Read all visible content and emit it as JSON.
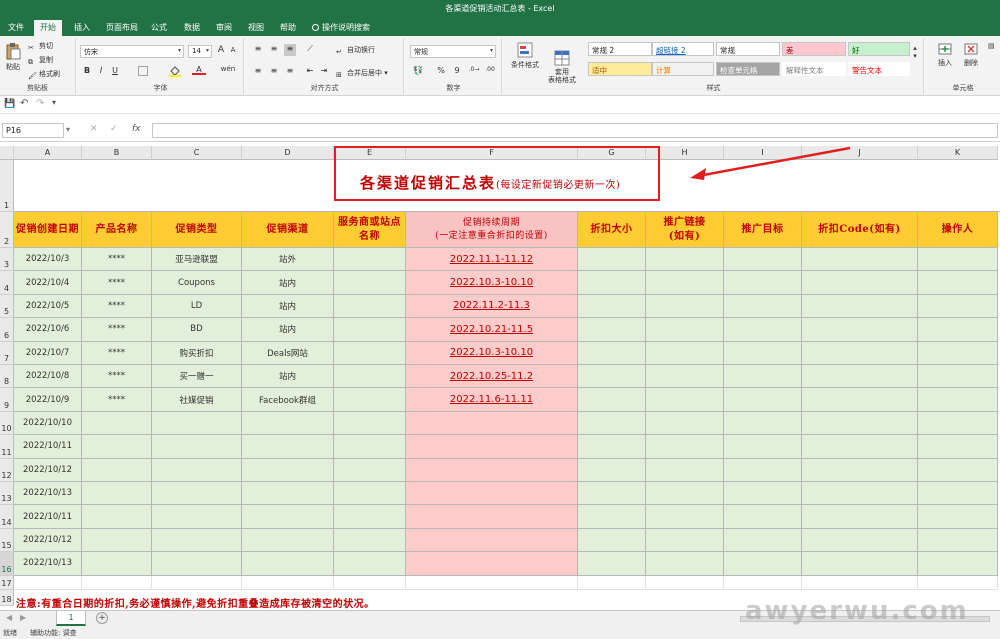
{
  "window": {
    "title": "各渠道促销活动汇总表 - Excel"
  },
  "tabs": [
    "文件",
    "开始",
    "插入",
    "页面布局",
    "公式",
    "数据",
    "审阅",
    "视图",
    "帮助",
    "操作说明搜索"
  ],
  "ribbon": {
    "clipboard": {
      "paste": "粘贴",
      "cut": "剪切",
      "copy": "复制",
      "format_painter": "格式刷",
      "label": "剪贴板"
    },
    "font": {
      "name": "仿宋",
      "size": "14",
      "bold": "B",
      "italic": "I",
      "underline": "U",
      "grow": "A",
      "shrink": "A",
      "color_a": "A",
      "wen": "wén",
      "label": "字体"
    },
    "alignment": {
      "wrap": "自动换行",
      "merge": "合并后居中",
      "label": "对齐方式"
    },
    "number": {
      "format": "常规",
      "percent": "%",
      "comma": "9",
      "label": "数字"
    },
    "styles": {
      "conditional": "条件格式",
      "table": "套用\n表格格式",
      "cells": [
        {
          "text": "常规 2",
          "bg": "#ffffff",
          "fg": "#222222"
        },
        {
          "text": "超链接 2",
          "bg": "#ffffff",
          "fg": "#0563c1"
        },
        {
          "text": "常规",
          "bg": "#ffffff",
          "fg": "#222222"
        },
        {
          "text": "差",
          "bg": "#ffc7ce",
          "fg": "#9c0006"
        },
        {
          "text": "好",
          "bg": "#c6efce",
          "fg": "#006100"
        },
        {
          "text": "适中",
          "bg": "#ffeb9c",
          "fg": "#9c5700"
        },
        {
          "text": "计算",
          "bg": "#f2f2f2",
          "fg": "#fa7d00"
        },
        {
          "text": "检查单元格",
          "bg": "#a5a5a5",
          "fg": "#ffffff"
        },
        {
          "text": "解释性文本",
          "bg": "#ffffff",
          "fg": "#7f7f7f"
        },
        {
          "text": "警告文本",
          "bg": "#ffffff",
          "fg": "#ff0000"
        }
      ],
      "label": "样式"
    },
    "cells": {
      "insert": "插入",
      "delete": "删除",
      "label": "单元格"
    }
  },
  "formula_bar": {
    "name_box": "P16",
    "fx": "fx",
    "value": ""
  },
  "columns": [
    "A",
    "B",
    "C",
    "D",
    "E",
    "F",
    "G",
    "H",
    "I",
    "J",
    "K"
  ],
  "sheet": {
    "title": "各渠道促销汇总表",
    "title_note": "(每设定新促销必更新一次)",
    "headers": [
      "促销创建日期",
      "产品名称",
      "促销类型",
      "促销渠道",
      "服务商或站点名称",
      "促销持续周期\n(一定注意重合折扣的设置)",
      "折扣大小",
      "推广链接\n(如有)",
      "推广目标",
      "折扣Code(如有)",
      "操作人"
    ],
    "rows": [
      [
        "2022/10/3",
        "****",
        "亚马逊联盟",
        "站外",
        "",
        "2022.11.1-11.12"
      ],
      [
        "2022/10/4",
        "****",
        "Coupons",
        "站内",
        "",
        "2022.10.3-10.10"
      ],
      [
        "2022/10/5",
        "****",
        "LD",
        "站内",
        "",
        "2022.11.2-11.3"
      ],
      [
        "2022/10/6",
        "****",
        "BD",
        "站内",
        "",
        "2022.10.21-11.5"
      ],
      [
        "2022/10/7",
        "****",
        "购买折扣",
        "Deals网站",
        "",
        "2022.10.3-10.10"
      ],
      [
        "2022/10/8",
        "****",
        "买一赠一",
        "站内",
        "",
        "2022.10.25-11.2"
      ],
      [
        "2022/10/9",
        "****",
        "社媒促销",
        "Facebook群组",
        "",
        "2022.11.6-11.11"
      ],
      [
        "2022/10/10",
        "",
        "",
        "",
        "",
        ""
      ],
      [
        "2022/10/11",
        "",
        "",
        "",
        "",
        ""
      ],
      [
        "2022/10/12",
        "",
        "",
        "",
        "",
        ""
      ],
      [
        "2022/10/13",
        "",
        "",
        "",
        "",
        ""
      ],
      [
        "2022/10/11",
        "",
        "",
        "",
        "",
        ""
      ],
      [
        "2022/10/12",
        "",
        "",
        "",
        "",
        ""
      ],
      [
        "2022/10/13",
        "",
        "",
        "",
        "",
        ""
      ]
    ],
    "note": "注意:有重合日期的折扣,务必谨慎操作,避免折扣重叠造成库存被清空的状况。"
  },
  "row_numbers": [
    "1",
    "2",
    "3",
    "4",
    "5",
    "6",
    "7",
    "8",
    "9",
    "10",
    "11",
    "12",
    "13",
    "14",
    "15",
    "16",
    "17",
    "18"
  ],
  "sheet_tabs": [
    "1"
  ],
  "status": {
    "ready": "就绪",
    "accessibility": "辅助功能: 调查"
  },
  "watermark": "awyerwu.com"
}
